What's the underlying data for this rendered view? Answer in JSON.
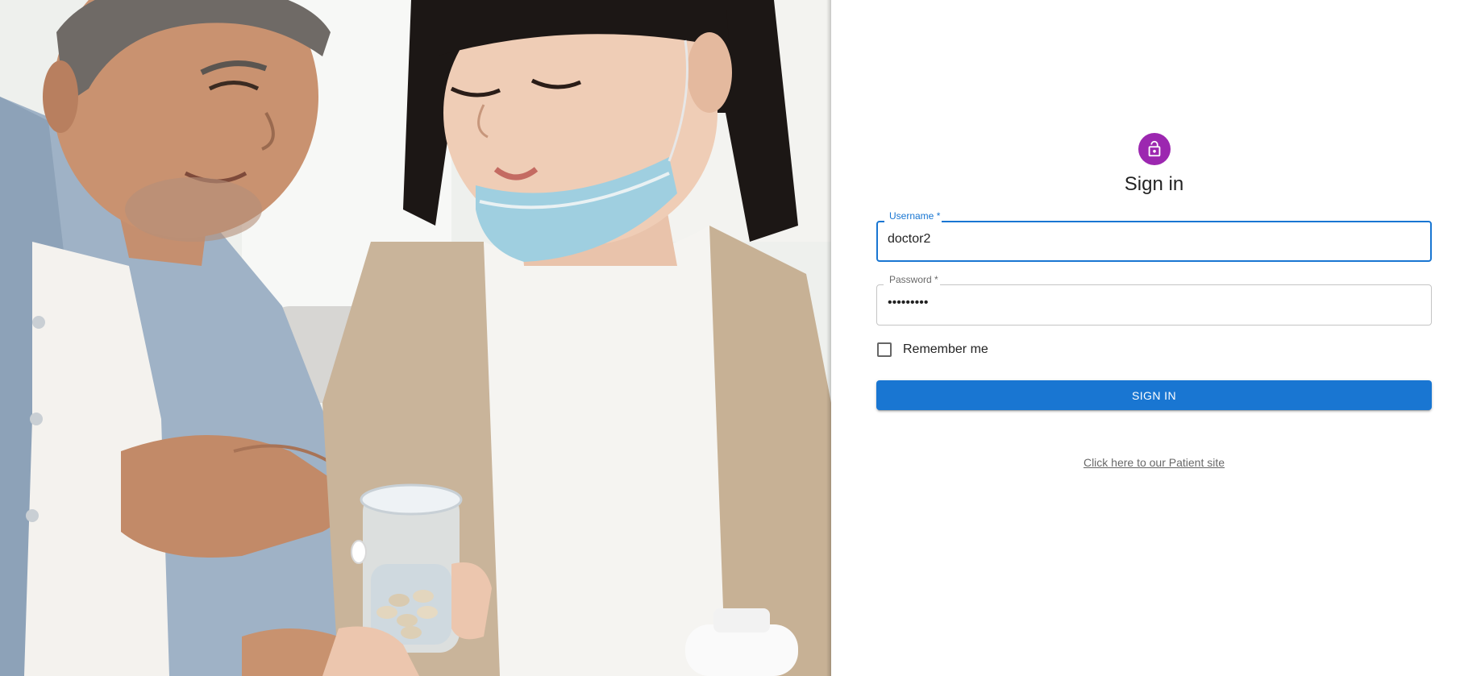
{
  "hero": {
    "image_description_icon": "photo-hero"
  },
  "form": {
    "avatar_icon": "lock-open-icon",
    "avatar_color": "#9c27b0",
    "title": "Sign in",
    "username": {
      "label": "Username *",
      "value": "doctor2"
    },
    "password": {
      "label": "Password *",
      "value": "•••••••••"
    },
    "remember_label": "Remember me",
    "remember_checked": false,
    "submit_label": "SIGN IN",
    "accent_color": "#1976d2",
    "patient_link": "Click here to our Patient site"
  }
}
